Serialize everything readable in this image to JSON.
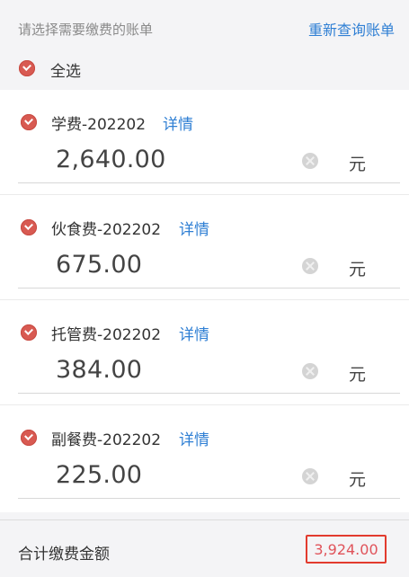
{
  "header": {
    "prompt": "请选择需要缴费的账单",
    "requery_label": "重新查询账单",
    "select_all_label": "全选"
  },
  "bills": [
    {
      "title": "学费-202202",
      "detail_label": "详情",
      "amount": "2,640.00",
      "unit": "元",
      "checked": true
    },
    {
      "title": "伙食费-202202",
      "detail_label": "详情",
      "amount": "675.00",
      "unit": "元",
      "checked": true
    },
    {
      "title": "托管费-202202",
      "detail_label": "详情",
      "amount": "384.00",
      "unit": "元",
      "checked": true
    },
    {
      "title": "副餐费-202202",
      "detail_label": "详情",
      "amount": "225.00",
      "unit": "元",
      "checked": true
    }
  ],
  "footer": {
    "total_label": "合计缴费金额",
    "total_value": "3,924.00"
  },
  "colors": {
    "accent_link": "#2f7fd4",
    "check_red": "#d85a52",
    "total_red": "#e0535a",
    "highlight_border": "#e23b2e"
  }
}
